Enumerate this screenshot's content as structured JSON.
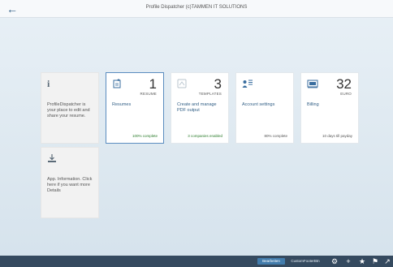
{
  "header": {
    "back_icon": "←",
    "title": "Profile Dispatcher (c)TAMMEN IT SOLUTIONS"
  },
  "tiles": [
    {
      "icon": "i",
      "icon_name": "info-icon",
      "number": "",
      "unit": "",
      "title": "ProfileDispatcher is your place to edit and share your resume.",
      "footer": ""
    },
    {
      "icon": "🖹",
      "icon_name": "resume-icon",
      "number": "1",
      "unit": "RESUME",
      "title": "Resumes",
      "footer": "100% complete"
    },
    {
      "icon": "☐",
      "icon_name": "template-icon",
      "number": "3",
      "unit": "TEMPLATES",
      "title": "Create and manage PDF output",
      "footer": "3 companies enabled"
    },
    {
      "icon": "▪≡",
      "icon_name": "account-settings-icon",
      "number": "",
      "unit": "",
      "title": "Account settings",
      "footer": "80% complete"
    },
    {
      "icon": "▣",
      "icon_name": "billing-icon",
      "number": "32",
      "unit": "EURO",
      "title": "Billing",
      "footer": "10 days till payday"
    },
    {
      "icon": "⤓",
      "icon_name": "download-icon",
      "number": "",
      "unit": "",
      "title": "App. Information. Click here if you want more Details",
      "footer": ""
    }
  ],
  "footer": {
    "edit_label": "Bearbeiten",
    "custom_label": "CustomFooterBtn",
    "icons": {
      "settings": "⚙",
      "add": "+",
      "favorite": "★",
      "flag": "⚑",
      "share": "↗"
    }
  }
}
